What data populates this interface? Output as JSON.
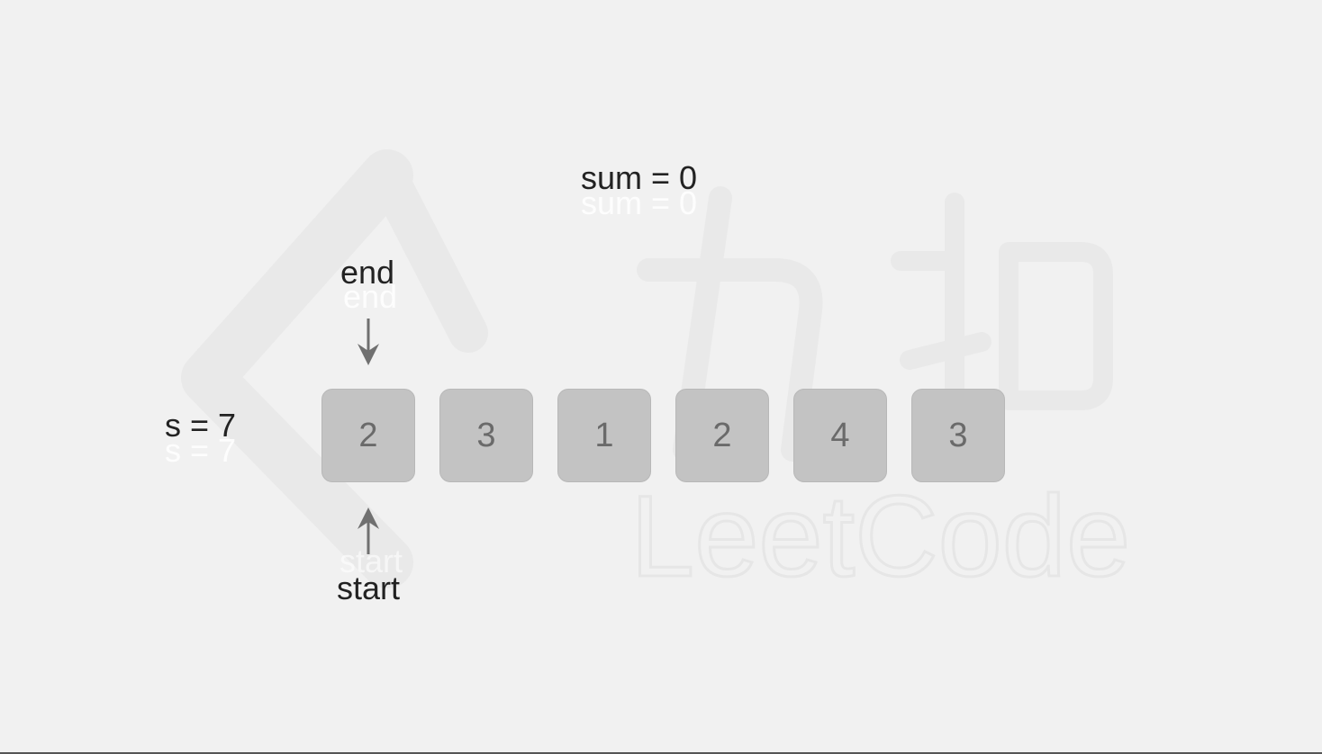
{
  "watermark": {
    "brand_text": "LeetCode",
    "chinese_text": "力扣"
  },
  "labels": {
    "sum": "sum = 0",
    "target": "s = 7",
    "end_pointer": "end",
    "start_pointer": "start"
  },
  "array": [
    2,
    3,
    1,
    2,
    4,
    3
  ],
  "colors": {
    "background": "#f1f1f1",
    "cell_fill": "#c3c3c3",
    "arrow": "#707070",
    "text": "#222222"
  }
}
